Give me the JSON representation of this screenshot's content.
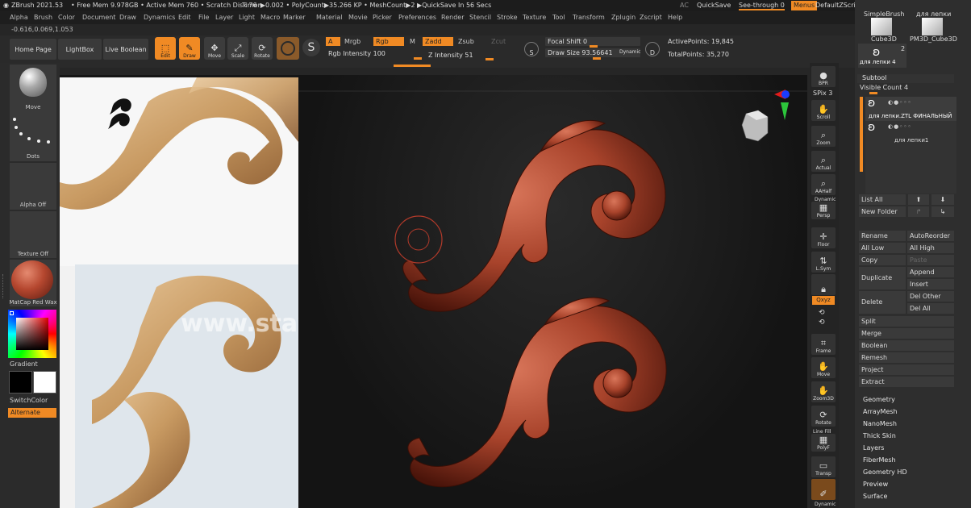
{
  "titlebar": {
    "app": "ZBrush 2021.5",
    "num": "3",
    "stats": "• Free Mem 9.978GB • Active Mem 760 • Scratch Disk 76 •",
    "timer": "Timer▶0.002 • PolyCount▶35.266 KP • MeshCount▶2 ▶QuickSave In 56 Secs",
    "ac": "AC",
    "quicksave": "QuickSave",
    "seethrough": "See-through  0",
    "menus": "Menus",
    "defaultzscript": "DefaultZScript"
  },
  "menubar": [
    "Alpha",
    "Brush",
    "Color",
    "Document",
    "Draw",
    "Dynamics",
    "Edit",
    "File",
    "Layer",
    "Light",
    "Macro",
    "Marker",
    "Material",
    "Movie",
    "Picker",
    "Preferences",
    "Render",
    "Stencil",
    "Stroke",
    "Texture",
    "Tool",
    "Transform",
    "Zplugin",
    "Zscript",
    "Help"
  ],
  "coords": "-0.616,0.069,1.053",
  "shelf": {
    "home_page": "Home Page",
    "lightbox": "LightBox",
    "live_boolean": "Live Boolean",
    "edit": "Edit",
    "draw": "Draw",
    "move": "Move",
    "scale": "Scale",
    "rotate": "Rotate",
    "a": "A",
    "mrgb": "Mrgb",
    "rgb": "Rgb",
    "m": "M",
    "zadd": "Zadd",
    "zsub": "Zsub",
    "zcut": "Zcut",
    "rgb_intensity": "Rgb Intensity 100",
    "z_intensity": "Z Intensity 51",
    "focal_shift": "Focal Shift 0",
    "draw_size": "Draw Size 93.56641",
    "dynamic": "Dynamic",
    "s": "S",
    "d": "D",
    "active_points": "ActivePoints: 19,845",
    "total_points": "TotalPoints: 35,270"
  },
  "lefttray": {
    "move": "Move",
    "dots": "Dots",
    "alpha_off": "Alpha Off",
    "texture_off": "Texture Off",
    "matcap": "MatCap Red Wax",
    "gradient": "Gradient",
    "switchcolor": "SwitchColor",
    "alternate": "Alternate"
  },
  "reference_watermark": "www.stav",
  "rightshelf": {
    "bpr": "BPR",
    "spix": "SPix 3",
    "scroll": "Scroll",
    "zoom": "Zoom",
    "actual": "Actual",
    "aahalf": "AAHalf",
    "dynamic": "Dynamic",
    "persp": "Persp",
    "floor": "Floor",
    "lsym": "L.Sym",
    "xyz": "Qxyz",
    "frame": "Frame",
    "move": "Move",
    "zoom3d": "Zoom3D",
    "rotate": "Rotate",
    "linefill": "Line Fill",
    "polyf": "PolyF",
    "transp": "Transp",
    "dynamic2": "Dynamic"
  },
  "rightpanel": {
    "simplebrush": "SimpleBrush",
    "dlya_lepki_top": "для лепки",
    "cube3d": "Cube3D",
    "pm3d_cube3d": "PM3D_Cube3D",
    "count": "2",
    "dlya_lepki4": "для лепки 4",
    "subtool": "Subtool",
    "visible_count": "Visible Count 4",
    "subtool1": "для лепки.ZTL ФИНАЛЬНЫЙ",
    "subtool2": "для лепки1",
    "list_all": "List All",
    "new_folder": "New Folder",
    "rename": "Rename",
    "autoreorder": "AutoReorder",
    "all_low": "All Low",
    "all_high": "All High",
    "copy": "Copy",
    "paste": "Paste",
    "duplicate": "Duplicate",
    "append": "Append",
    "insert": "Insert",
    "delete": "Delete",
    "del_other": "Del Other",
    "del_all": "Del All",
    "split": "Split",
    "merge": "Merge",
    "boolean": "Boolean",
    "remesh": "Remesh",
    "project": "Project",
    "extract": "Extract",
    "sections": [
      "Geometry",
      "ArrayMesh",
      "NanoMesh",
      "Thick Skin",
      "Layers",
      "FiberMesh",
      "Geometry HD",
      "Preview",
      "Surface"
    ]
  }
}
